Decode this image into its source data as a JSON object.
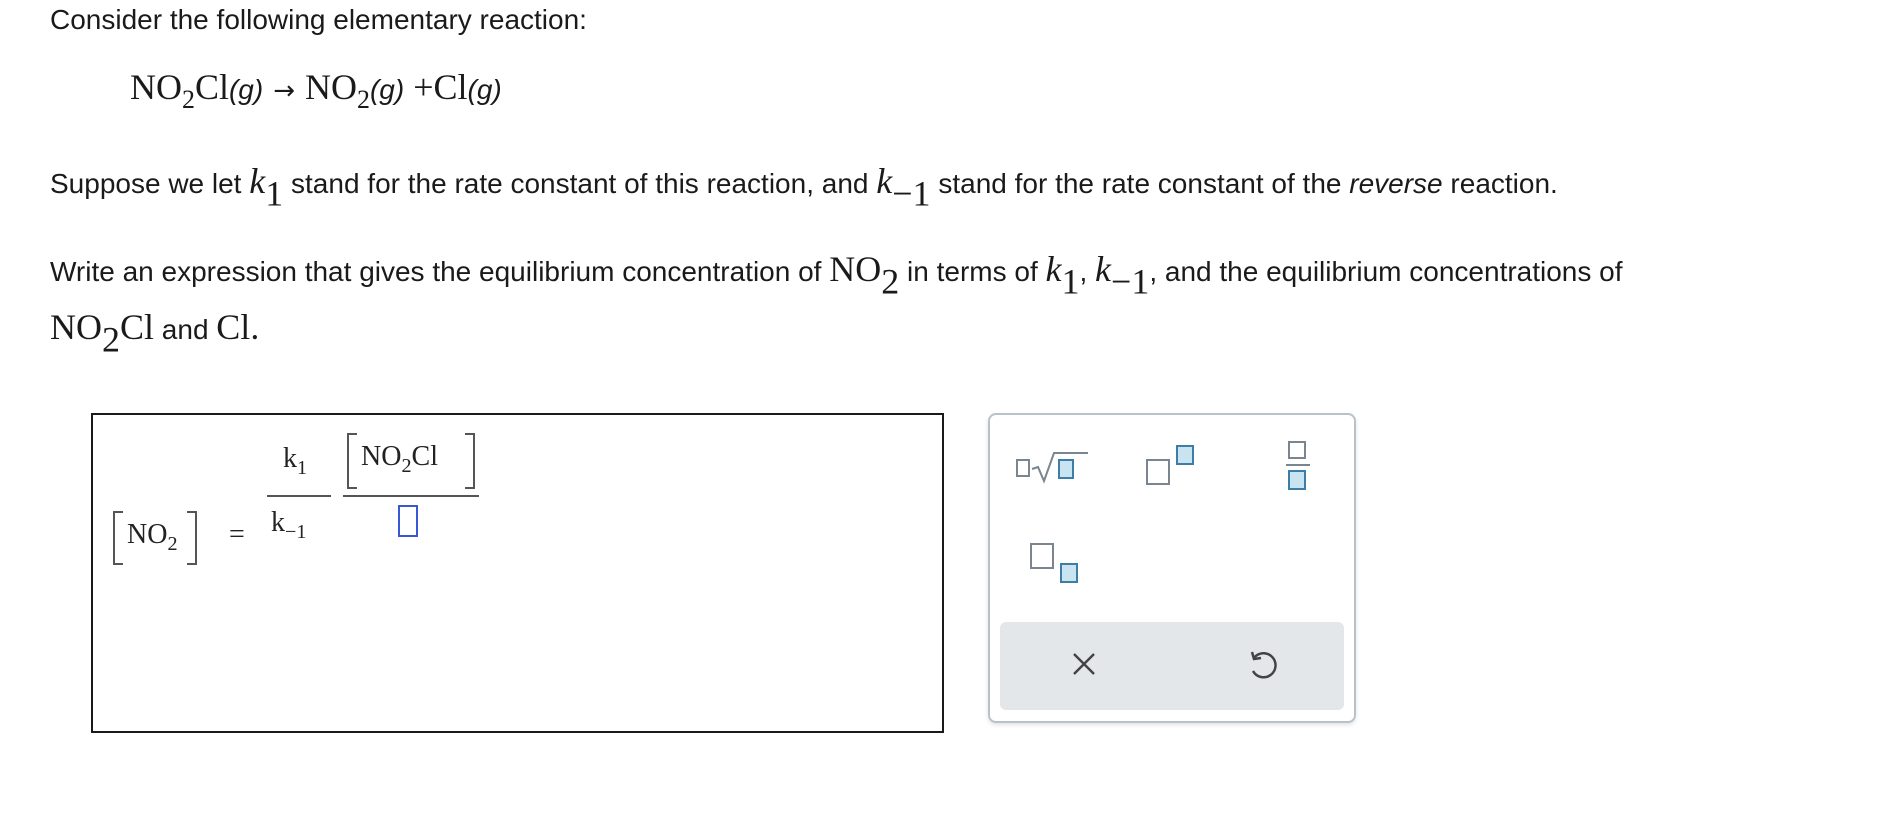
{
  "question": {
    "intro": "Consider the following elementary reaction:",
    "reaction": {
      "reactant": {
        "formula": "NO",
        "sub": "2",
        "rest": "Cl",
        "state": "(g)"
      },
      "arrow": "→",
      "product1": {
        "formula": "NO",
        "sub": "2",
        "state": "(g)"
      },
      "plus": "+",
      "product2": {
        "formula": "Cl",
        "state": "(g)"
      }
    },
    "constants_text": {
      "a": "Suppose we let ",
      "k": "k",
      "k1_sub": "1",
      "b": " stand for the rate constant of this reaction, and ",
      "km1_sub": "−1",
      "c": " stand for the rate constant of the ",
      "reverse": "reverse",
      "d": " reaction."
    },
    "write_text": {
      "a": "Write an expression that gives the equilibrium concentration of ",
      "no2": "NO",
      "no2_sub": "2",
      "b": " in terms of ",
      "comma": ", ",
      "c": ", and the equilibrium concentrations of",
      "no2cl_a": "NO",
      "no2cl_sub": "2",
      "no2cl_b": "Cl",
      "and": " and ",
      "cl": "Cl",
      "period": "."
    }
  },
  "answer": {
    "lhs_species": "NO",
    "lhs_sub": "2",
    "equals": "=",
    "k_num": "k",
    "k_num_sub": "1",
    "k_den": "k",
    "k_den_sub": "−1",
    "num_species_a": "NO",
    "num_species_sub": "2",
    "num_species_b": "Cl"
  },
  "palette": {
    "accent": "#3d7ea6",
    "tools": [
      "radical-tool",
      "superscript-tool",
      "fraction-tool",
      "subscript-tool"
    ],
    "actions": {
      "clear_glyph": "×",
      "undo_glyph": "↺"
    }
  }
}
